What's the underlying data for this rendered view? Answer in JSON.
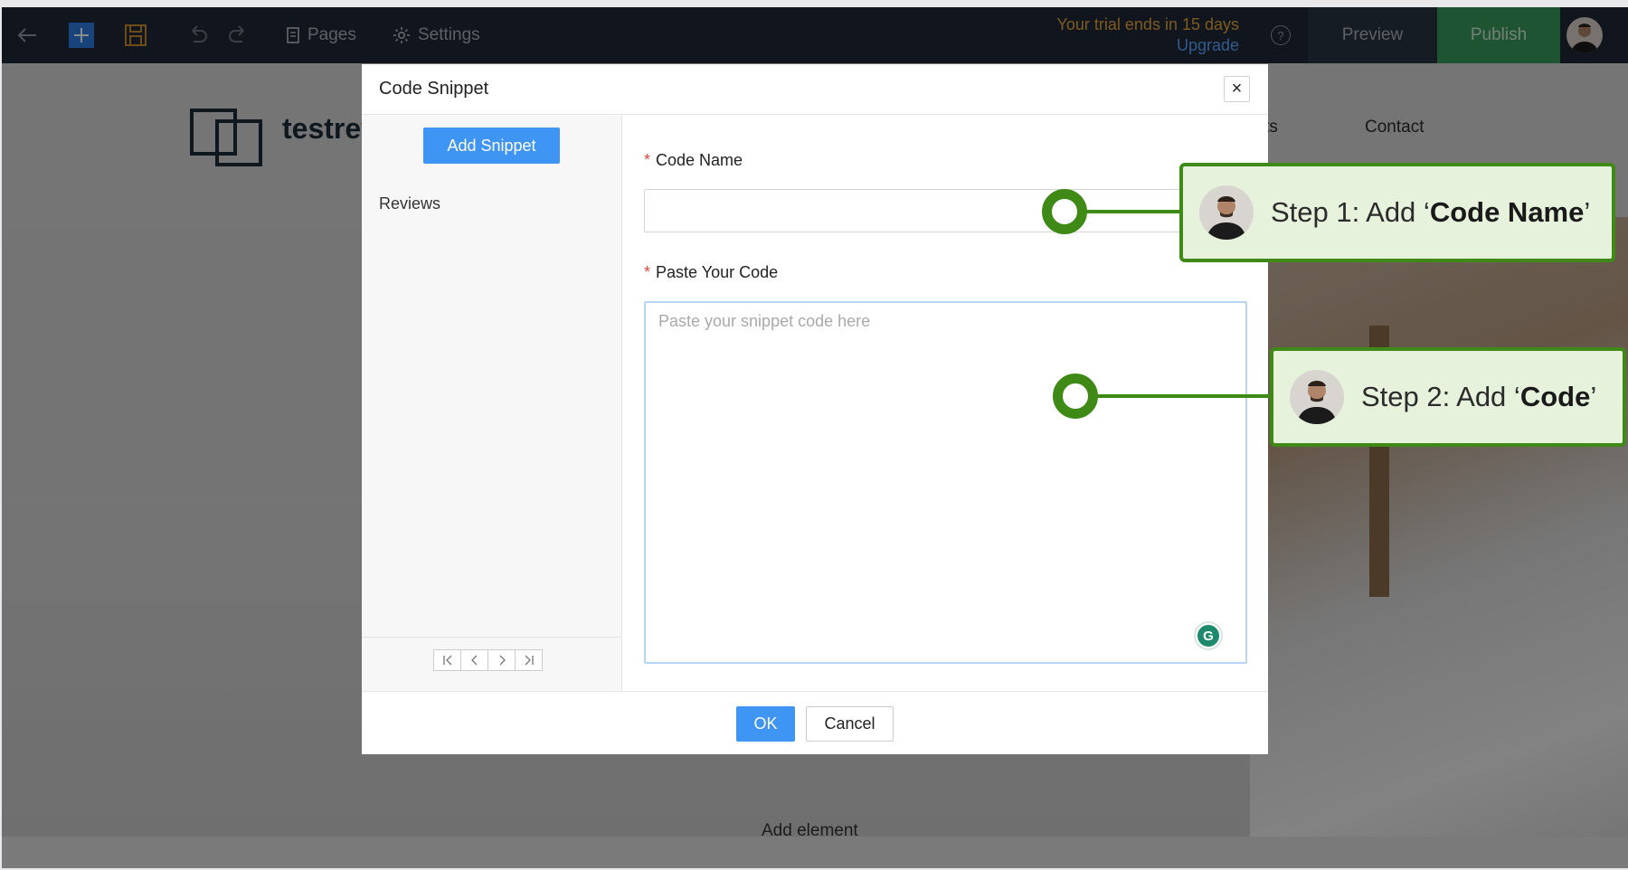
{
  "toolbar": {
    "pages_label": "Pages",
    "settings_label": "Settings",
    "trial_text": "Your trial ends in 15 days",
    "upgrade_label": "Upgrade",
    "help_icon": "?",
    "preview_label": "Preview",
    "publish_label": "Publish"
  },
  "site": {
    "name": "testrev",
    "nav": [
      "ects",
      "Contact"
    ],
    "add_element": "Add element"
  },
  "modal": {
    "title": "Code Snippet",
    "close_icon": "×",
    "add_snippet_label": "Add Snippet",
    "snippets": [
      "Reviews"
    ],
    "pager": [
      "first-page-icon",
      "prev-page-icon",
      "next-page-icon",
      "last-page-icon"
    ],
    "code_name_label": "Code Name",
    "code_name_value": "",
    "code_label": "Paste Your Code",
    "code_placeholder": "Paste your snippet code here",
    "required_mark": "*",
    "grammarly_label": "G",
    "ok_label": "OK",
    "cancel_label": "Cancel"
  },
  "steps": [
    {
      "prefix": "Step 1: Add ‘",
      "bold": "Code Name",
      "suffix": "’"
    },
    {
      "prefix": "Step 2: Add ‘",
      "bold": "Code",
      "suffix": "’"
    }
  ],
  "colors": {
    "accent": "#3f95f3",
    "step_green": "#3f8a17",
    "callout_bg": "#e6f2dc",
    "publish_green": "#3a9a5c",
    "trial_orange": "#e5a53a"
  }
}
